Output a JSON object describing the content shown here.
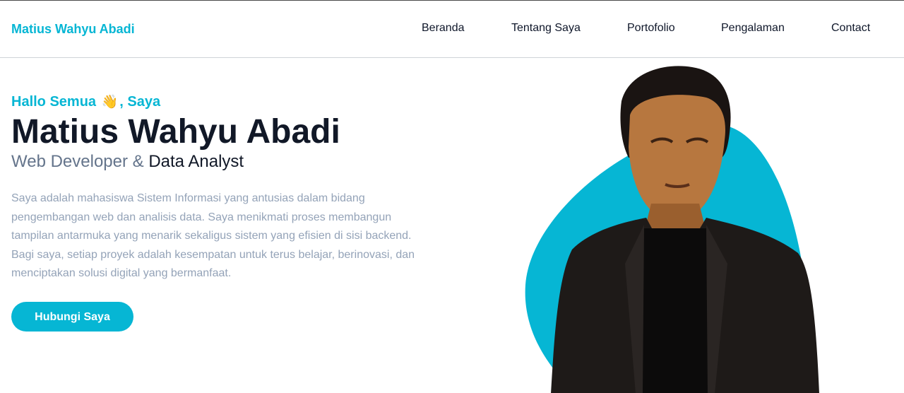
{
  "header": {
    "logo": "Matius Wahyu Abadi",
    "nav": [
      {
        "label": "Beranda"
      },
      {
        "label": "Tentang Saya"
      },
      {
        "label": "Portofolio"
      },
      {
        "label": "Pengalaman"
      },
      {
        "label": "Contact"
      }
    ]
  },
  "hero": {
    "greeting_pre": "Hallo Semua",
    "greeting_emoji": "👋",
    "greeting_post": ", Saya",
    "name": "Matius Wahyu Abadi",
    "role_primary": "Web Developer &",
    "role_secondary": "Data Analyst",
    "bio": "Saya adalah mahasiswa Sistem Informasi yang antusias dalam bidang pengembangan web dan analisis data. Saya menikmati proses membangun tampilan antarmuka yang menarik sekaligus sistem yang efisien di sisi backend. Bagi saya, setiap proyek adalah kesempatan untuk terus belajar, berinovasi, dan menciptakan solusi digital yang bermanfaat.",
    "cta_label": "Hubungi Saya"
  },
  "colors": {
    "accent": "#06b6d4",
    "heading": "#111827",
    "muted": "#64748b",
    "body_text": "#94a3b8"
  },
  "icons": {
    "wave": "waving-hand-icon"
  }
}
